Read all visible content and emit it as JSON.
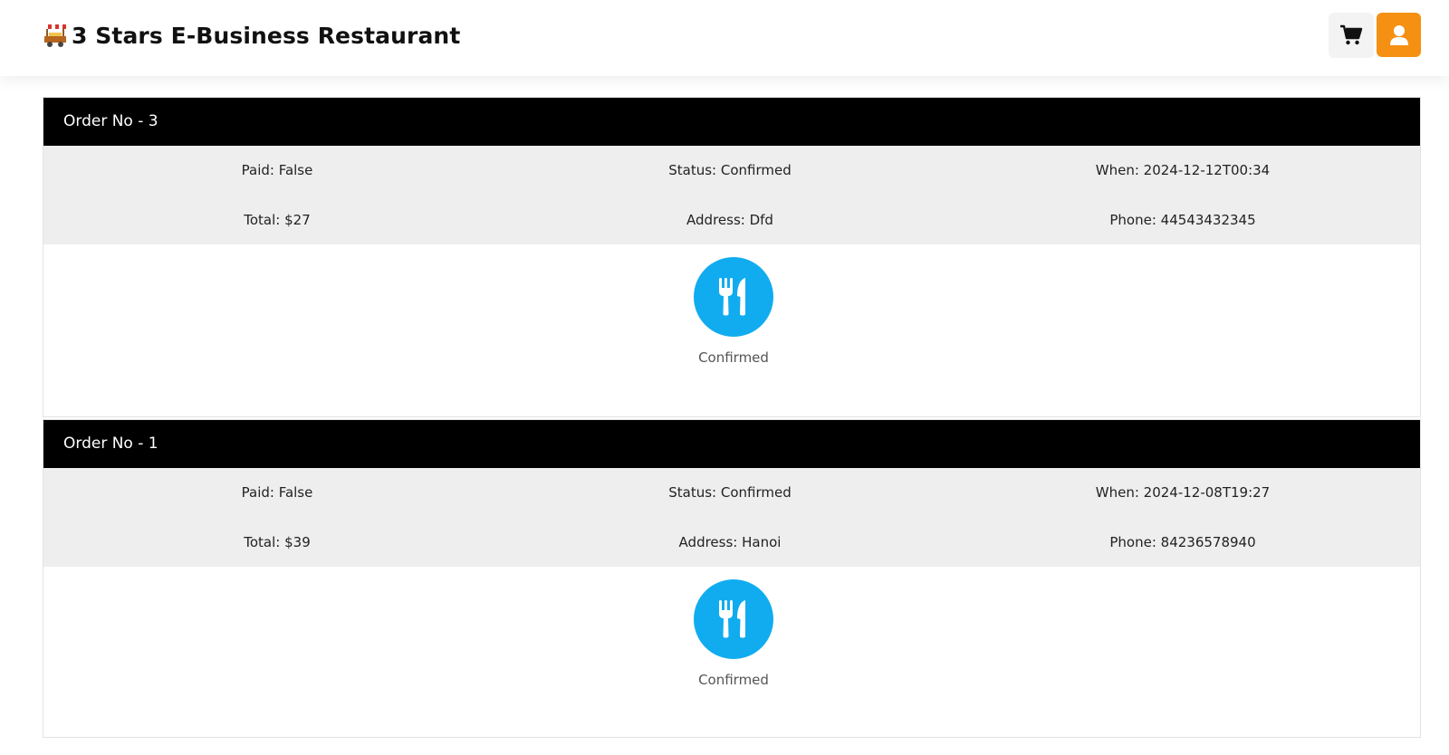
{
  "header": {
    "brand_name": "3 Stars E-Business Restaurant",
    "logo_icon": "food-cart-icon",
    "cart_icon": "shopping-cart-icon",
    "user_icon": "user-icon",
    "accent_color": "#f59012"
  },
  "orders": [
    {
      "title": "Order No - 3",
      "paid": "Paid: False",
      "status": "Status: Confirmed",
      "when": "When: 2024-12-12T00:34",
      "total": "Total: $27",
      "address": "Address: Dfd",
      "phone": "Phone: 44543432345",
      "status_icon": "utensils-icon",
      "status_label": "Confirmed"
    },
    {
      "title": "Order No - 1",
      "paid": "Paid: False",
      "status": "Status: Confirmed",
      "when": "When: 2024-12-08T19:27",
      "total": "Total: $39",
      "address": "Address: Hanoi",
      "phone": "Phone: 84236578940",
      "status_icon": "utensils-icon",
      "status_label": "Confirmed"
    }
  ],
  "colors": {
    "order_header_bg": "#000000",
    "details_bg": "#eeeeee",
    "status_icon_bg": "#10acef"
  }
}
